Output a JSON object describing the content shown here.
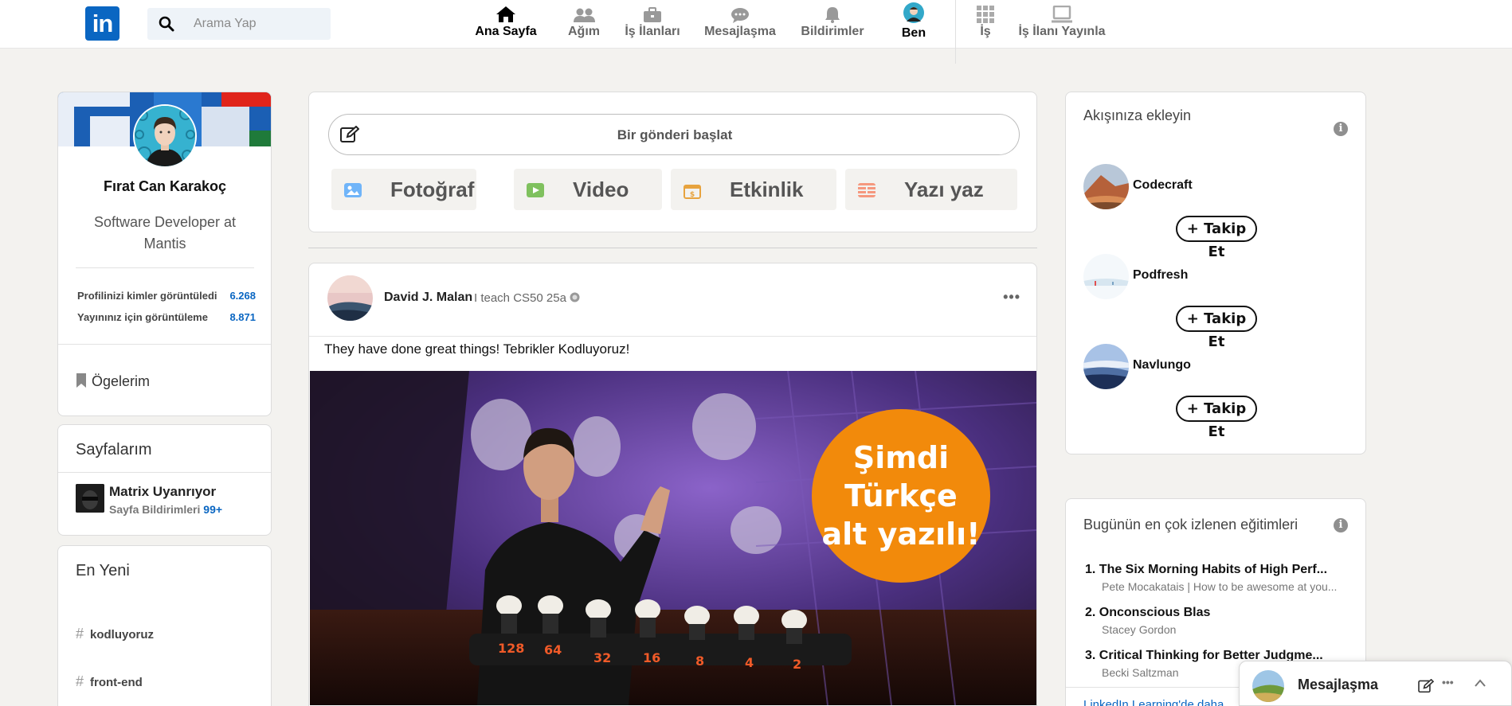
{
  "search": {
    "placeholder": "Arama Yap"
  },
  "nav": [
    {
      "label": "Ana Sayfa",
      "icon": "home-icon"
    },
    {
      "label": "Ağım",
      "icon": "network-icon"
    },
    {
      "label": "İş İlanları",
      "icon": "briefcase-icon"
    },
    {
      "label": "Mesajlaşma",
      "icon": "chat-icon"
    },
    {
      "label": "Bildirimler",
      "icon": "bell-icon"
    },
    {
      "label": "Ben",
      "icon": "me-avatar"
    },
    {
      "label": "İş",
      "icon": "grid-icon"
    },
    {
      "label": "İş İlanı Yayınla",
      "icon": "post-job-icon"
    }
  ],
  "profile": {
    "name": "Fırat Can Karakoç",
    "title": "Software Developer at Mantis",
    "stats": [
      {
        "label": "Profilinizi kimler görüntüledi",
        "value": "6.268"
      },
      {
        "label": "Yayınınız için görüntüleme",
        "value": "8.871"
      }
    ],
    "items_label": "Ögelerim"
  },
  "pages": {
    "title": "Sayfalarım",
    "name": "Matrix Uyanrıyor",
    "sub": "Sayfa Bildirimleri",
    "count": "99+"
  },
  "recent": {
    "title": "En Yeni",
    "tags": [
      "kodluyoruz",
      "front-end"
    ]
  },
  "share": {
    "start_post": "Bir gönderi başlat",
    "buttons": [
      {
        "label": "Fotoğraf",
        "icon": "photo-icon",
        "color": "#70b5f9"
      },
      {
        "label": "Video",
        "icon": "video-icon",
        "color": "#7fc15e"
      },
      {
        "label": "Etkinlik",
        "icon": "event-icon",
        "color": "#e7a33e"
      },
      {
        "label": "Yazı yaz",
        "icon": "article-icon",
        "color": "#f5987e"
      }
    ]
  },
  "post": {
    "author": "David J. Malan",
    "meta": "I teach CS50 25a",
    "text": "They have done great things! Tebrikler Kodluyoruz!",
    "badge_lines": [
      "Şimdi",
      "Türkçe",
      "alt yazılı!"
    ],
    "bulb_labels": [
      "128",
      "64",
      "32",
      "16",
      "8",
      "4",
      "2"
    ]
  },
  "follow": {
    "title": "Akışınıza ekleyin",
    "button_label": "+ Takip Et",
    "companies": [
      "Codecraft",
      "Podfresh",
      "Navlungo"
    ]
  },
  "courses": {
    "title": "Bugünün en çok izlenen eğitimleri",
    "items": [
      {
        "title": "1. The Six Morning Habits of High Perf...",
        "sub": "Pete Mocakatais | How to be awesome at you..."
      },
      {
        "title": "2. Onconscious Blas",
        "sub": "Stacey Gordon"
      },
      {
        "title": "3. Critical Thinking for Better Judgme...",
        "sub": "Becki Saltzman"
      }
    ],
    "link": "LinkedIn Learning'de daha..."
  },
  "messaging": {
    "label": "Mesajlaşma"
  },
  "colors": {
    "brand": "#0a66c2",
    "badge": "#f28a0b",
    "background": "#f3f2ef"
  }
}
